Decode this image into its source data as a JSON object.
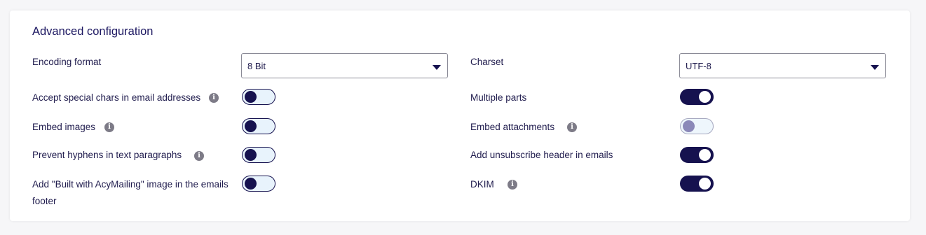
{
  "section_title": "Advanced configuration",
  "left": {
    "encoding": {
      "label": "Encoding format",
      "value": "8 Bit"
    },
    "special_chars": {
      "label": "Accept special chars in email addresses",
      "state": "off"
    },
    "embed_images": {
      "label": "Embed images",
      "state": "off"
    },
    "prevent_hyphens": {
      "label": "Prevent hyphens in text paragraphs",
      "state": "off"
    },
    "built_with": {
      "label": "Add \"Built with AcyMailing\" image in the emails footer",
      "state": "off"
    }
  },
  "right": {
    "charset": {
      "label": "Charset",
      "value": "UTF-8"
    },
    "multiple_parts": {
      "label": "Multiple parts",
      "state": "on"
    },
    "embed_attachments": {
      "label": "Embed attachments",
      "state": "off-disabled"
    },
    "unsubscribe_header": {
      "label": "Add unsubscribe header in emails",
      "state": "on"
    },
    "dkim": {
      "label": "DKIM",
      "state": "on"
    }
  },
  "colors": {
    "accent": "#16124f",
    "toggle_off_bg": "#e8f3fc",
    "info_icon": "#7d7b87"
  }
}
